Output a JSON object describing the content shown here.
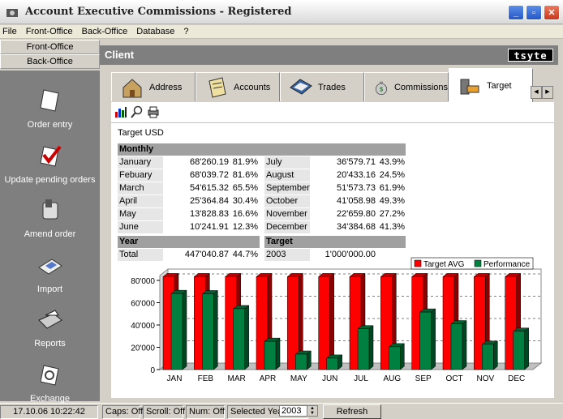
{
  "window": {
    "title": "Account Executive Commissions - Registered"
  },
  "menu": [
    "File",
    "Front-Office",
    "Back-Office",
    "Database",
    "?"
  ],
  "sidebar": {
    "tabs": [
      "Front-Office",
      "Back-Office"
    ],
    "items": [
      {
        "label": "Order entry",
        "icon": "blank-page-icon"
      },
      {
        "label": "Update pending orders",
        "icon": "check-page-icon"
      },
      {
        "label": "Amend order",
        "icon": "phone-icon"
      },
      {
        "label": "Import",
        "icon": "disk-icon"
      },
      {
        "label": "Reports",
        "icon": "printer-icon"
      },
      {
        "label": "Exchange",
        "icon": "exchange-icon"
      }
    ]
  },
  "header": {
    "title": "Client",
    "logo": "tsyte"
  },
  "tabs": [
    {
      "label": "Address",
      "icon": "address-icon",
      "active": false
    },
    {
      "label": "Accounts",
      "icon": "accounts-icon",
      "active": false
    },
    {
      "label": "Trades",
      "icon": "trades-icon",
      "active": false
    },
    {
      "label": "Commissions",
      "icon": "commissions-icon",
      "active": false
    },
    {
      "label": "Target",
      "icon": "target-icon",
      "active": true
    }
  ],
  "toolbar": [
    "chart-icon",
    "search-icon",
    "print-icon"
  ],
  "target": {
    "title": "Target USD",
    "monthly_header": "Monthly",
    "months_left": [
      {
        "month": "January",
        "value": "68'260.19",
        "pct": "81.9%"
      },
      {
        "month": "Febuary",
        "value": "68'039.72",
        "pct": "81.6%"
      },
      {
        "month": "March",
        "value": "54'615.32",
        "pct": "65.5%"
      },
      {
        "month": "April",
        "value": "25'364.84",
        "pct": "30.4%"
      },
      {
        "month": "May",
        "value": "13'828.83",
        "pct": "16.6%"
      },
      {
        "month": "June",
        "value": "10'241.91",
        "pct": "12.3%"
      }
    ],
    "months_right": [
      {
        "month": "July",
        "value": "36'579.71",
        "pct": "43.9%"
      },
      {
        "month": "August",
        "value": "20'433.16",
        "pct": "24.5%"
      },
      {
        "month": "September",
        "value": "51'573.73",
        "pct": "61.9%"
      },
      {
        "month": "October",
        "value": "41'058.98",
        "pct": "49.3%"
      },
      {
        "month": "November",
        "value": "22'659.80",
        "pct": "27.2%"
      },
      {
        "month": "December",
        "value": "34'384.68",
        "pct": "41.3%"
      }
    ],
    "year_header": "Year",
    "target_header": "Target",
    "total_label": "Total",
    "total_value": "447'040.87",
    "total_pct": "44.7%",
    "target_year": "2003",
    "target_value": "1'000'000.00"
  },
  "chart_data": {
    "type": "bar",
    "categories": [
      "JAN",
      "FEB",
      "MAR",
      "APR",
      "MAY",
      "JUN",
      "JUL",
      "AUG",
      "SEP",
      "OCT",
      "NOV",
      "DEC"
    ],
    "series": [
      {
        "name": "Target AVG",
        "color": "#ff0000",
        "values": [
          83333,
          83333,
          83333,
          83333,
          83333,
          83333,
          83333,
          83333,
          83333,
          83333,
          83333,
          83333
        ]
      },
      {
        "name": "Performance",
        "color": "#008040",
        "values": [
          68260,
          68040,
          54615,
          25365,
          13829,
          10242,
          36580,
          20433,
          51574,
          41059,
          22660,
          34385
        ]
      }
    ],
    "yticks": [
      "80'000",
      "60'000",
      "40'000",
      "20'000",
      "0"
    ],
    "ylim": [
      0,
      80000
    ],
    "legend": "top-right",
    "grid": true
  },
  "status": {
    "datetime": "17.10.06 10:22:42",
    "caps": "Caps: Off",
    "scroll": "Scroll: Off",
    "num": "Num: Off",
    "year_label": "Selected Year",
    "year_value": "2003",
    "refresh": "Refresh"
  }
}
